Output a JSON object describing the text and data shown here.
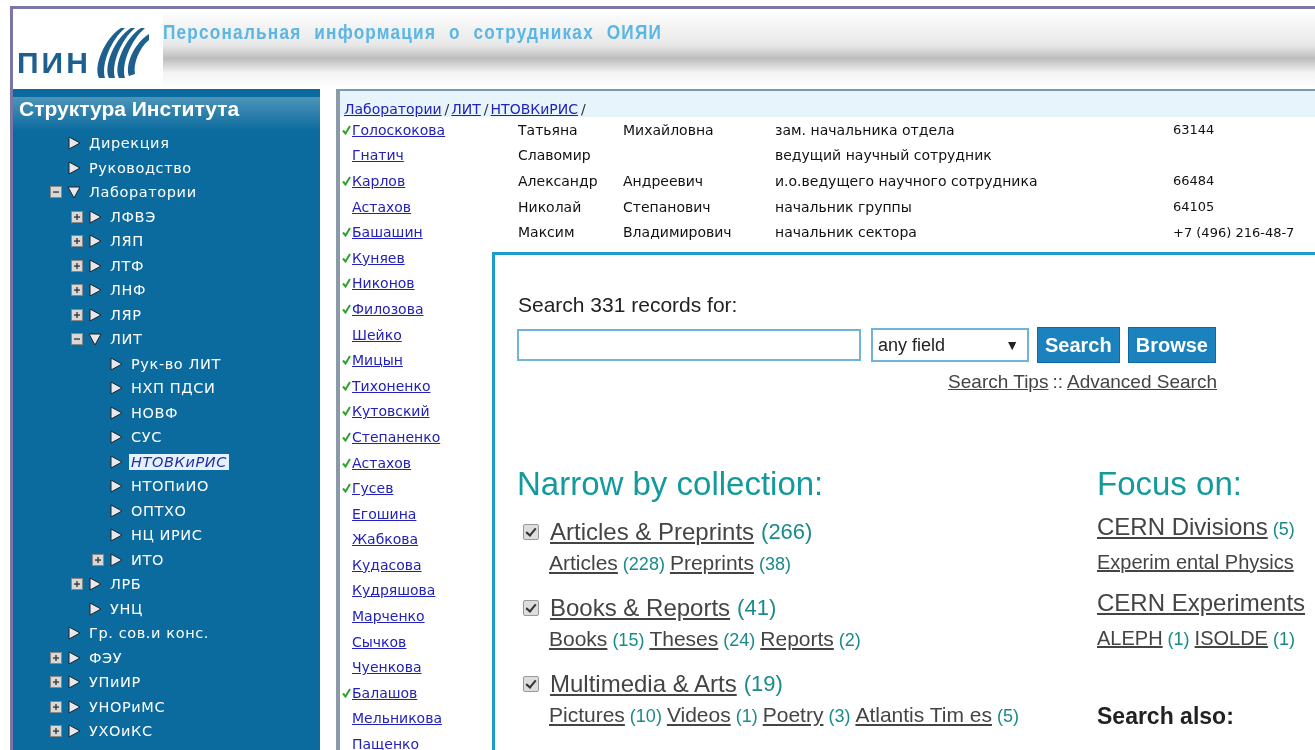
{
  "header": {
    "logo_text": "ПИН",
    "title": "Персональная информация о сотрудниках ОИЯИ"
  },
  "sidebar": {
    "title": "Структура Института",
    "items": [
      {
        "label": "Дирекция",
        "kind": "leaf",
        "expanded": false,
        "selected": false
      },
      {
        "label": "Руководство",
        "kind": "leaf",
        "expanded": false,
        "selected": false
      },
      {
        "label": "Лаборатории",
        "kind": "branch",
        "expanded": true,
        "selected": false,
        "children": [
          {
            "label": "ЛФВЭ",
            "kind": "branch",
            "expanded": false,
            "selected": false
          },
          {
            "label": "ЛЯП",
            "kind": "branch",
            "expanded": false,
            "selected": false
          },
          {
            "label": "ЛТФ",
            "kind": "branch",
            "expanded": false,
            "selected": false
          },
          {
            "label": "ЛНФ",
            "kind": "branch",
            "expanded": false,
            "selected": false
          },
          {
            "label": "ЛЯР",
            "kind": "branch",
            "expanded": false,
            "selected": false
          },
          {
            "label": "ЛИТ",
            "kind": "branch",
            "expanded": true,
            "selected": false,
            "children": [
              {
                "label": "Рук-во ЛИТ",
                "kind": "leaf",
                "expanded": false,
                "selected": false
              },
              {
                "label": "НХП ПДСИ",
                "kind": "leaf",
                "expanded": false,
                "selected": false
              },
              {
                "label": "НОВФ",
                "kind": "leaf",
                "expanded": false,
                "selected": false
              },
              {
                "label": "СУС",
                "kind": "leaf",
                "expanded": false,
                "selected": false
              },
              {
                "label": "НТОВКиРИС",
                "kind": "leaf",
                "expanded": false,
                "selected": true
              },
              {
                "label": "НТОПиИО",
                "kind": "leaf",
                "expanded": false,
                "selected": false
              },
              {
                "label": "ОПТХО",
                "kind": "leaf",
                "expanded": false,
                "selected": false
              },
              {
                "label": "НЦ ИРИС",
                "kind": "leaf",
                "expanded": false,
                "selected": false
              },
              {
                "label": "ИТО",
                "kind": "branch",
                "expanded": false,
                "selected": false
              }
            ]
          },
          {
            "label": "ЛРБ",
            "kind": "branch",
            "expanded": false,
            "selected": false
          },
          {
            "label": "УНЦ",
            "kind": "leaf",
            "expanded": false,
            "selected": false
          }
        ]
      },
      {
        "label": "Гр. сов.и конс.",
        "kind": "leaf",
        "expanded": false,
        "selected": false
      },
      {
        "label": "ФЭУ",
        "kind": "branch",
        "expanded": false,
        "selected": false
      },
      {
        "label": "УПиИР",
        "kind": "branch",
        "expanded": false,
        "selected": false
      },
      {
        "label": "УНОРиМС",
        "kind": "branch",
        "expanded": false,
        "selected": false
      },
      {
        "label": "УХОиКС",
        "kind": "branch",
        "expanded": false,
        "selected": false
      }
    ]
  },
  "breadcrumb": [
    {
      "label": "Лаборатории",
      "separator": "/"
    },
    {
      "label": "ЛИТ",
      "separator": "/"
    },
    {
      "label": "НТОВКиРИС",
      "separator": "/"
    }
  ],
  "employees": [
    {
      "surname": "Голоскокова",
      "verified": true,
      "first_name": "Татьяна",
      "patronymic": "Михайловна",
      "position": "зам. начальника отдела",
      "phone": "63144"
    },
    {
      "surname": "Гнатич",
      "verified": false,
      "first_name": "Славомир",
      "position": "ведущий научный сотрудник"
    },
    {
      "surname": "Карлов",
      "verified": true,
      "first_name": "Александр",
      "patronymic": "Андреевич",
      "position": "и.о.ведущего научного сотрудника",
      "phone": "66484"
    },
    {
      "surname": "Астахов",
      "verified": false,
      "first_name": "Николай",
      "patronymic": "Степанович",
      "position": "начальник группы",
      "phone": "64105"
    },
    {
      "surname": "Башашин",
      "verified": true,
      "first_name": "Максим",
      "patronymic": "Владимирович",
      "position": "начальник сектора",
      "phone": "+7 (496) 216-48-7"
    },
    {
      "surname": "Куняев",
      "verified": true
    },
    {
      "surname": "Никонов",
      "verified": true
    },
    {
      "surname": "Филозова",
      "verified": true
    },
    {
      "surname": "Шейко",
      "verified": false
    },
    {
      "surname": "Мицын",
      "verified": true
    },
    {
      "surname": "Тихоненко",
      "verified": true
    },
    {
      "surname": "Кутовский",
      "verified": true
    },
    {
      "surname": "Степаненко",
      "verified": true
    },
    {
      "surname": "Астахов",
      "verified": true
    },
    {
      "surname": "Гусев",
      "verified": true
    },
    {
      "surname": "Егошина",
      "verified": false
    },
    {
      "surname": "Жабкова",
      "verified": false
    },
    {
      "surname": "Кудасова",
      "verified": false
    },
    {
      "surname": "Кудряшова",
      "verified": false
    },
    {
      "surname": "Марченко",
      "verified": false
    },
    {
      "surname": "Сычков",
      "verified": false
    },
    {
      "surname": "Чуенкова",
      "verified": false
    },
    {
      "surname": "Балашов",
      "verified": true
    },
    {
      "surname": "Мельникова",
      "verified": false
    },
    {
      "surname": "Пащенко",
      "verified": false
    }
  ],
  "search_panel": {
    "label": "Search 331 records for:",
    "field_select": "any field",
    "select_arrow": "▼",
    "buttons": [
      "Search",
      "Browse"
    ],
    "links": [
      "Search Tips",
      "Advanced Search"
    ],
    "link_separator": "::",
    "narrow": {
      "title": "Narrow by collection:",
      "collections": [
        {
          "name": "Articles & Preprints",
          "count": "(266)",
          "checked": true,
          "subs": [
            {
              "name": "Articles",
              "count": "(228)"
            },
            {
              "name": "Preprints",
              "count": "(38)"
            }
          ]
        },
        {
          "name": "Books & Reports",
          "count": "(41)",
          "checked": true,
          "subs": [
            {
              "name": "Books",
              "count": "(15)"
            },
            {
              "name": "Theses",
              "count": "(24)"
            },
            {
              "name": "Reports",
              "count": "(2)"
            }
          ]
        },
        {
          "name": "Multimedia & Arts",
          "count": "(19)",
          "checked": true,
          "subs": [
            {
              "name": "Pictures",
              "count": "(10)"
            },
            {
              "name": "Videos",
              "count": "(1)"
            },
            {
              "name": "Poetry",
              "count": "(3)"
            },
            {
              "name": "Atlantis Tim es",
              "count": "(5)"
            }
          ]
        }
      ]
    },
    "focus": {
      "title": "Focus on:",
      "rows": [
        [
          {
            "name": "CERN Divisions",
            "count": "(5)"
          }
        ],
        [
          {
            "name": "Experim ental Physics"
          }
        ],
        [
          {
            "name": "CERN Experiments"
          }
        ],
        [
          {
            "name": "ALEPH",
            "count": "(1)"
          },
          {
            "name": "ISOLDE",
            "count": "(1)"
          }
        ]
      ]
    },
    "search_also": {
      "title": "Search also:"
    }
  }
}
